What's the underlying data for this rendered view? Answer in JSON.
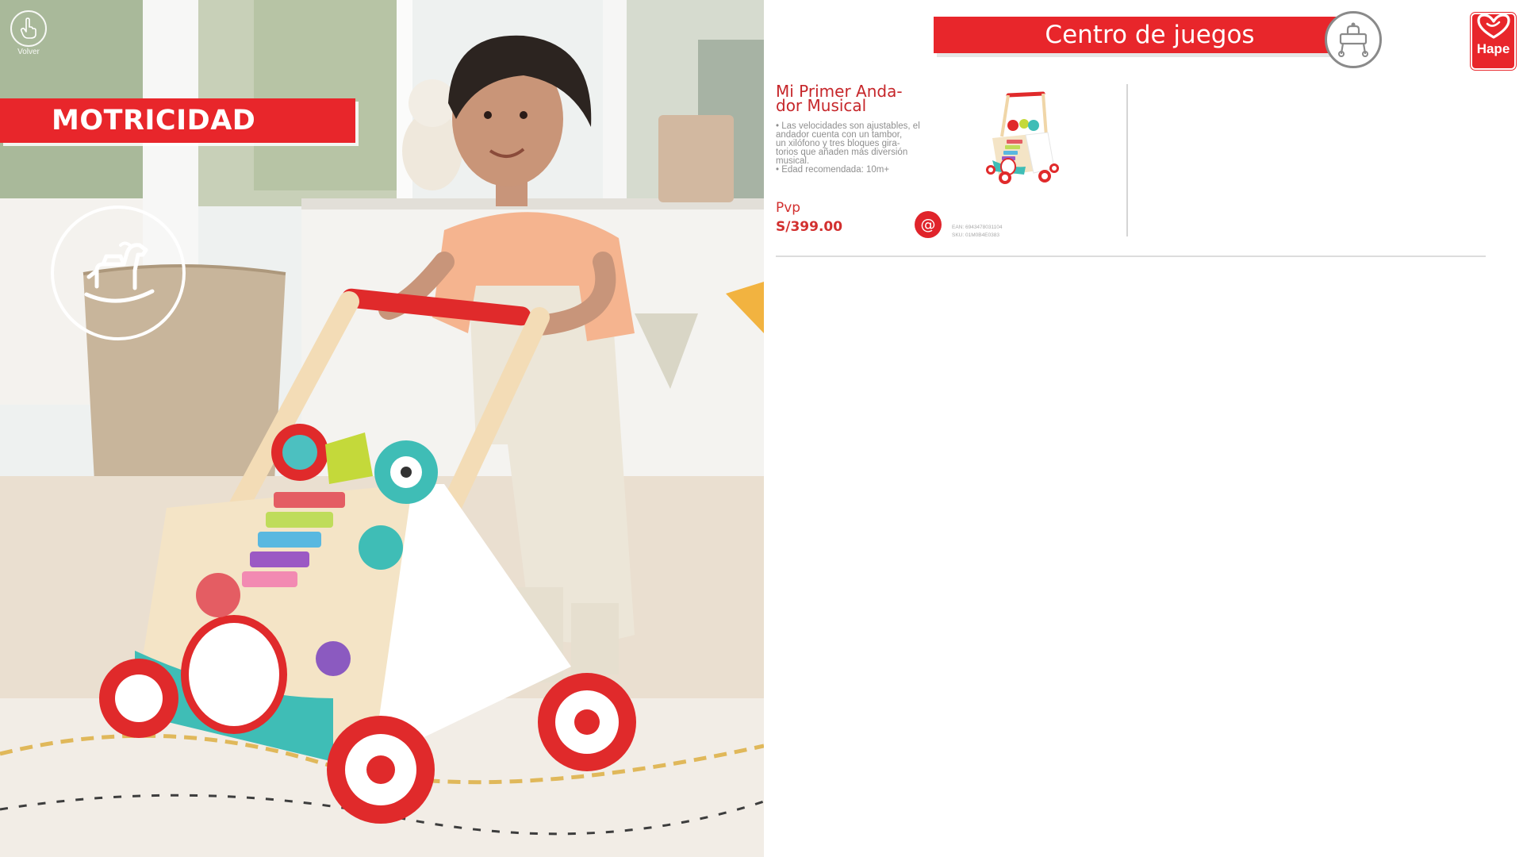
{
  "nav": {
    "back_label": "Volver"
  },
  "section": {
    "label": "MOTRICIDAD",
    "badge_icon": "rocking-horse-icon"
  },
  "header": {
    "title": "Centro de juegos",
    "icon": "baby-walker-icon"
  },
  "brand": {
    "name": "Hape"
  },
  "product": {
    "name_lines": [
      "Mi Primer Anda-",
      "dor Musical"
    ],
    "description_lines": [
      "• Las velocidades son ajustables, el",
      "andador cuenta con un tambor,",
      "un xilófono y tres bloques gira-",
      "torios que añaden más diversión",
      "musical.",
      "• Edad recomendada: 10m+"
    ],
    "pvp_label": "Pvp",
    "price": "S/399.00",
    "web_icon_label": "@",
    "codes": [
      "EAN: 6943478031104",
      "SKU: 01M0B4E0383"
    ]
  },
  "colors": {
    "accent": "#e8262b",
    "price": "#d2302f",
    "text_muted": "#8f8f8f"
  }
}
